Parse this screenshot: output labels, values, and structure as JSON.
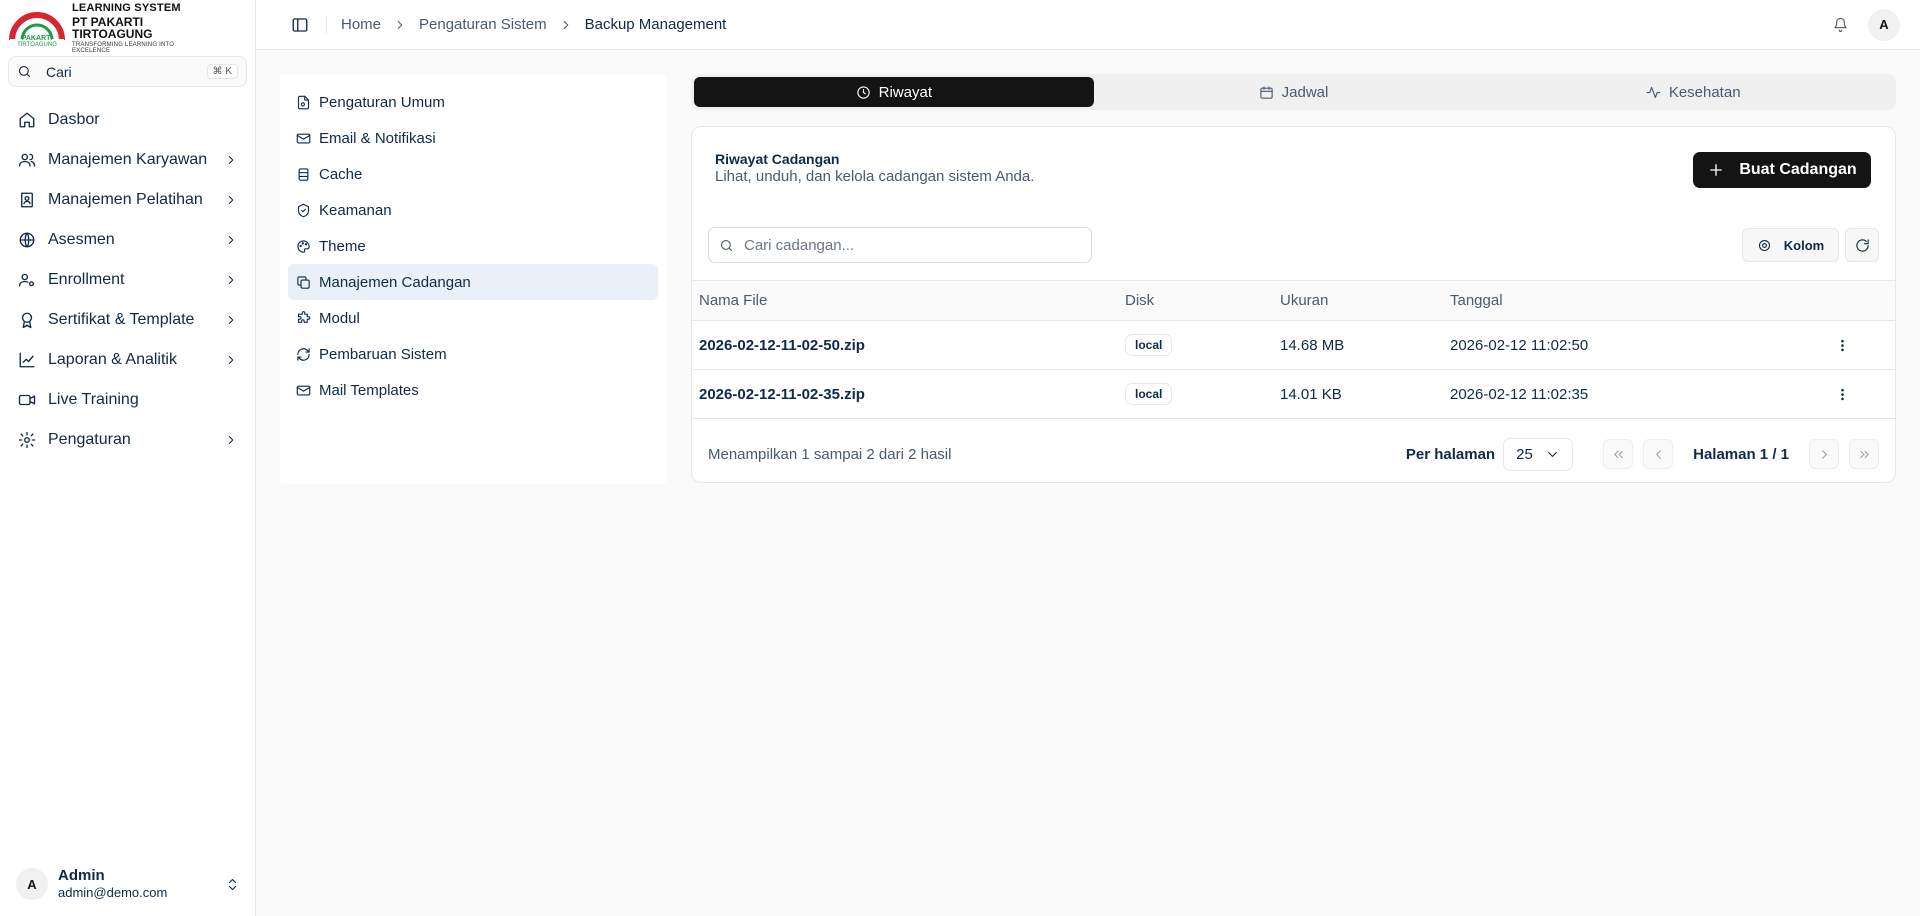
{
  "brand": {
    "line1": "LEARNING SYSTEM",
    "line2": "PT PAKARTI TIRTOAGUNG",
    "line3": "TRANSFORMING LEARNING INTO EXCELENCE",
    "colors": {
      "red": "#d6262f",
      "green": "#1f9a4a"
    }
  },
  "sidebar": {
    "search_label": "Cari",
    "search_shortcut": "⌘ K",
    "items": [
      {
        "label": "Dasbor",
        "icon": "home-icon",
        "has_children": false
      },
      {
        "label": "Manajemen Karyawan",
        "icon": "users-icon",
        "has_children": true
      },
      {
        "label": "Manajemen Pelatihan",
        "icon": "book-user-icon",
        "has_children": true
      },
      {
        "label": "Asesmen",
        "icon": "globe-icon",
        "has_children": true
      },
      {
        "label": "Enrollment",
        "icon": "user-cog-icon",
        "has_children": true
      },
      {
        "label": "Sertifikat & Template",
        "icon": "award-icon",
        "has_children": true
      },
      {
        "label": "Laporan & Analitik",
        "icon": "chart-line-icon",
        "has_children": true
      },
      {
        "label": "Live Training",
        "icon": "video-icon",
        "has_children": false
      },
      {
        "label": "Pengaturan",
        "icon": "settings-icon",
        "has_children": true
      }
    ],
    "user": {
      "initial": "A",
      "name": "Admin",
      "email": "admin@demo.com"
    }
  },
  "header": {
    "breadcrumb": [
      "Home",
      "Pengaturan Sistem",
      "Backup Management"
    ],
    "avatar_initial": "A"
  },
  "settings_menu": [
    {
      "label": "Pengaturan Umum",
      "icon": "file-cog-icon",
      "active": false
    },
    {
      "label": "Email & Notifikasi",
      "icon": "mail-check-icon",
      "active": false
    },
    {
      "label": "Cache",
      "icon": "database-icon",
      "active": false
    },
    {
      "label": "Keamanan",
      "icon": "shield-check-icon",
      "active": false
    },
    {
      "label": "Theme",
      "icon": "palette-icon",
      "active": false
    },
    {
      "label": "Manajemen Cadangan",
      "icon": "copy-icon",
      "active": true
    },
    {
      "label": "Modul",
      "icon": "puzzle-icon",
      "active": false
    },
    {
      "label": "Pembaruan Sistem",
      "icon": "refresh-icon",
      "active": false
    },
    {
      "label": "Mail Templates",
      "icon": "mail-open-icon",
      "active": false
    }
  ],
  "tabs": [
    {
      "label": "Riwayat",
      "icon": "clock-icon",
      "active": true
    },
    {
      "label": "Jadwal",
      "icon": "calendar-icon",
      "active": false
    },
    {
      "label": "Kesehatan",
      "icon": "activity-icon",
      "active": false
    }
  ],
  "card": {
    "title": "Riwayat Cadangan",
    "description": "Lihat, unduh, dan kelola cadangan sistem Anda.",
    "create_button": "Buat Cadangan",
    "search_placeholder": "Cari cadangan...",
    "columns_button": "Kolom"
  },
  "table": {
    "headers": [
      "Nama File",
      "Disk",
      "Ukuran",
      "Tanggal"
    ],
    "rows": [
      {
        "name": "2026-02-12-11-02-50.zip",
        "disk": "local",
        "size": "14.68 MB",
        "date": "2026-02-12 11:02:50"
      },
      {
        "name": "2026-02-12-11-02-35.zip",
        "disk": "local",
        "size": "14.01 KB",
        "date": "2026-02-12 11:02:35"
      }
    ]
  },
  "pagination": {
    "summary": "Menampilkan 1 sampai 2 dari 2 hasil",
    "per_page_label": "Per halaman",
    "per_page_value": "25",
    "page_label": "Halaman 1 / 1"
  }
}
